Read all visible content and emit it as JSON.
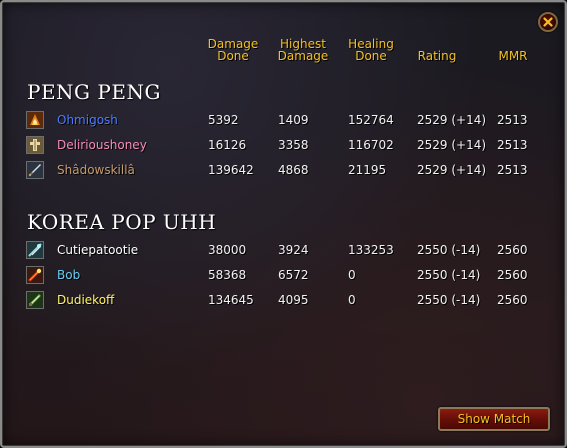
{
  "window": {
    "close_icon": "close-x-icon"
  },
  "columns": {
    "damage_done": [
      "Damage",
      "Done"
    ],
    "highest_damage": [
      "Highest",
      "Damage"
    ],
    "healing_done": [
      "Healing",
      "Done"
    ],
    "rating": "Rating",
    "mmr": "MMR"
  },
  "teams": [
    {
      "name": "PENG PENG",
      "players": [
        {
          "name": "Ohmigosh",
          "name_color": "#4d7bff",
          "icon": "mage-class-icon",
          "damage_done": "5392",
          "highest_damage": "1409",
          "healing_done": "152764",
          "rating": "2529 (+14)",
          "mmr": "2513"
        },
        {
          "name": "Delirioushoney",
          "name_color": "#f58cba",
          "icon": "paladin-class-icon",
          "damage_done": "16126",
          "highest_damage": "3358",
          "healing_done": "116702",
          "rating": "2529 (+14)",
          "mmr": "2513"
        },
        {
          "name": "Shâdowskillâ",
          "name_color": "#c79c6e",
          "icon": "warrior-class-icon",
          "damage_done": "139642",
          "highest_damage": "4868",
          "healing_done": "21195",
          "rating": "2529 (+14)",
          "mmr": "2513"
        }
      ]
    },
    {
      "name": "KOREA POP UHH",
      "players": [
        {
          "name": "Cutiepatootie",
          "name_color": "#ffffff",
          "icon": "priest-class-icon",
          "damage_done": "38000",
          "highest_damage": "3924",
          "healing_done": "133253",
          "rating": "2550 (-14)",
          "mmr": "2560"
        },
        {
          "name": "Bob",
          "name_color": "#69ccf0",
          "icon": "mage-fire-class-icon",
          "damage_done": "58368",
          "highest_damage": "6572",
          "healing_done": "0",
          "rating": "2550 (-14)",
          "mmr": "2560"
        },
        {
          "name": "Dudiekoff",
          "name_color": "#fff569",
          "icon": "rogue-class-icon",
          "damage_done": "134645",
          "highest_damage": "4095",
          "healing_done": "0",
          "rating": "2550 (-14)",
          "mmr": "2560"
        }
      ]
    }
  ],
  "buttons": {
    "show_match": "Show Match"
  },
  "colors": {
    "header_gold": "#f4c022",
    "button_red": "#7a140c",
    "text_white": "#f2f2f2"
  }
}
